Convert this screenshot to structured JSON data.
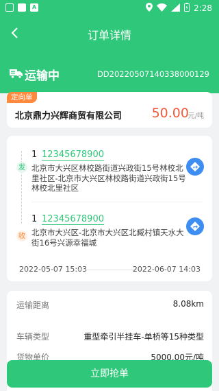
{
  "status_bar": {
    "time": "2:28"
  },
  "header": {
    "title": "订单详情",
    "status": "运输中",
    "order_no": "DD20220507140338000129"
  },
  "summary": {
    "tag": "定向单",
    "company": "北京鼎力兴辉商贸有限公司",
    "price": "50.00",
    "price_unit": "元/吨"
  },
  "route": {
    "sender": {
      "badge": "发",
      "count": "1",
      "phone": "12345678900",
      "address": "北京市大兴区林校路街道兴政街15号林校北里社区-北京市大兴区林校路街道兴政街15号林校北里社区"
    },
    "receiver": {
      "badge": "收",
      "count": "1",
      "phone": "12345678900",
      "address": "北京市大兴区-北京市大兴区北臧村镇天水大街16号兴源幸福城"
    },
    "start_time": "2022-05-07 15:03",
    "end_time": "2022-06-07 14:03"
  },
  "details": [
    {
      "label": "运输距离",
      "value": "8.08km"
    },
    {
      "label": "车辆类型",
      "value": "重型牵引半挂车-单桥等15种类型"
    },
    {
      "label": "货物单价",
      "value": "5000.00元/吨"
    }
  ],
  "action": {
    "label": "立即抢单"
  },
  "colors": {
    "brand": "#2fc77a",
    "price": "#f05a3a",
    "tag": "#ff8a3d",
    "nav": "#3d8ef0"
  }
}
